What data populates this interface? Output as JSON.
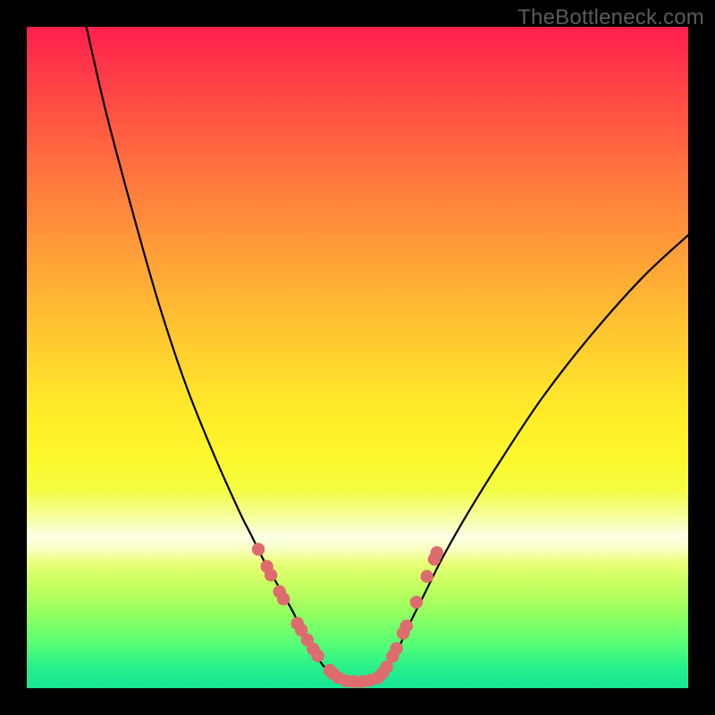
{
  "watermark": "TheBottleneck.com",
  "chart_data": {
    "type": "line",
    "title": "",
    "xlabel": "",
    "ylabel": "",
    "xlim": [
      0,
      100
    ],
    "ylim": [
      0,
      100
    ],
    "grid": false,
    "legend": false,
    "annotations": [],
    "series": [
      {
        "name": "left-curve",
        "x": [
          9,
          12,
          16,
          20,
          24,
          28,
          32,
          34,
          36,
          38,
          40,
          41,
          42,
          43,
          44,
          45,
          46,
          47
        ],
        "y": [
          100,
          87,
          72,
          58,
          46,
          36,
          27,
          23,
          19,
          15.5,
          12,
          10,
          8,
          6,
          4.5,
          3.2,
          2.1,
          1.4
        ]
      },
      {
        "name": "valley-floor",
        "x": [
          47,
          48,
          49,
          50,
          51,
          52,
          53
        ],
        "y": [
          1.4,
          1.1,
          1.0,
          1.0,
          1.0,
          1.1,
          1.4
        ]
      },
      {
        "name": "right-curve",
        "x": [
          53,
          54,
          55,
          56,
          57,
          58,
          60,
          63,
          67,
          72,
          78,
          85,
          93,
          100
        ],
        "y": [
          1.4,
          2.4,
          3.8,
          5.6,
          7.8,
          10,
          14,
          20,
          27,
          35,
          44,
          53,
          62,
          68.5
        ]
      }
    ],
    "markers": {
      "name": "sample-dots",
      "color": "#de6b6e",
      "points": [
        {
          "x": 35.0,
          "y": 21.0
        },
        {
          "x": 36.3,
          "y": 18.4
        },
        {
          "x": 36.9,
          "y": 17.1
        },
        {
          "x": 38.2,
          "y": 14.6
        },
        {
          "x": 38.8,
          "y": 13.5
        },
        {
          "x": 40.9,
          "y": 9.8
        },
        {
          "x": 41.5,
          "y": 8.8
        },
        {
          "x": 42.4,
          "y": 7.3
        },
        {
          "x": 43.3,
          "y": 5.9
        },
        {
          "x": 44.0,
          "y": 4.9
        },
        {
          "x": 45.8,
          "y": 2.7
        },
        {
          "x": 46.3,
          "y": 2.2
        },
        {
          "x": 47.1,
          "y": 1.6
        },
        {
          "x": 48.3,
          "y": 1.1
        },
        {
          "x": 49.5,
          "y": 1.0
        },
        {
          "x": 50.7,
          "y": 1.0
        },
        {
          "x": 51.9,
          "y": 1.2
        },
        {
          "x": 53.1,
          "y": 1.6
        },
        {
          "x": 53.8,
          "y": 2.3
        },
        {
          "x": 54.4,
          "y": 3.2
        },
        {
          "x": 55.3,
          "y": 4.8
        },
        {
          "x": 55.9,
          "y": 6.0
        },
        {
          "x": 56.9,
          "y": 8.3
        },
        {
          "x": 57.4,
          "y": 9.4
        },
        {
          "x": 58.9,
          "y": 13.0
        },
        {
          "x": 60.5,
          "y": 16.9
        },
        {
          "x": 61.6,
          "y": 19.5
        },
        {
          "x": 62.0,
          "y": 20.5
        }
      ]
    }
  }
}
